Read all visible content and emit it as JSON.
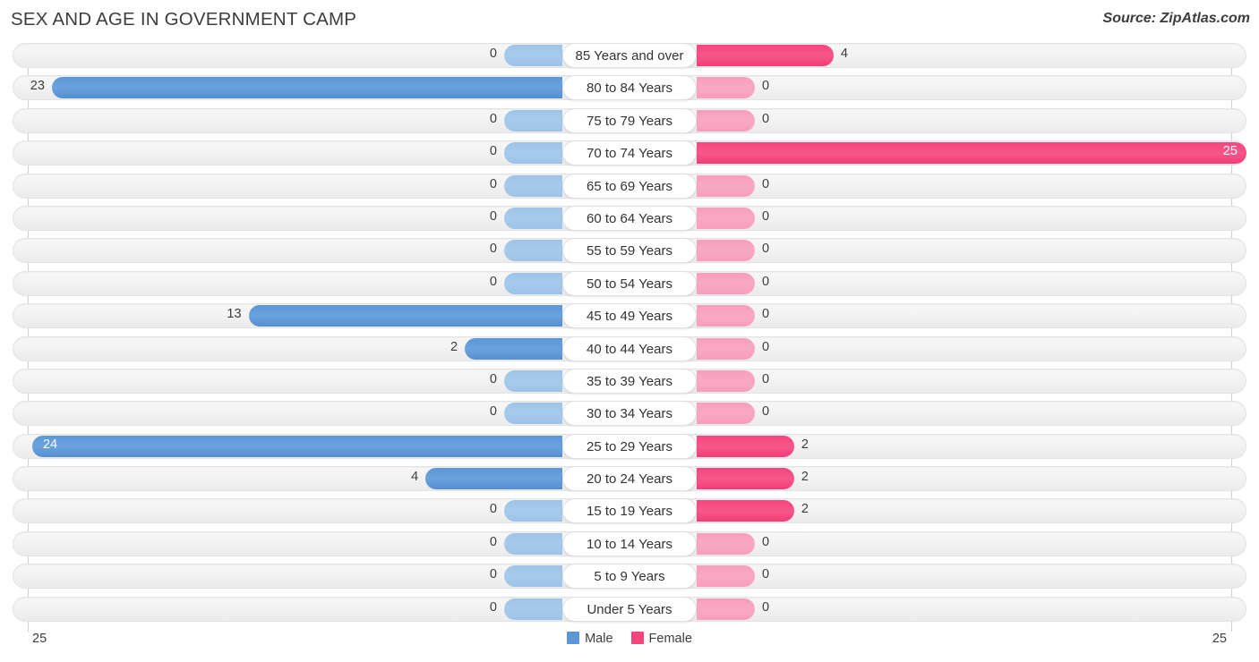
{
  "header": {
    "title": "SEX AND AGE IN GOVERNMENT CAMP",
    "source": "Source: ZipAtlas.com"
  },
  "axis": {
    "left_max": "25",
    "right_max": "25"
  },
  "legend": {
    "items": [
      {
        "label": "Male",
        "color": "#5b97d8"
      },
      {
        "label": "Female",
        "color": "#f4457e"
      }
    ]
  },
  "chart_data": {
    "type": "bar",
    "subtype": "population-pyramid",
    "title": "SEX AND AGE IN GOVERNMENT CAMP",
    "xlabel": "",
    "ylabel": "",
    "xlim": [
      0,
      25
    ],
    "grid": true,
    "legend_position": "bottom-center",
    "categories": [
      "85 Years and over",
      "80 to 84 Years",
      "75 to 79 Years",
      "70 to 74 Years",
      "65 to 69 Years",
      "60 to 64 Years",
      "55 to 59 Years",
      "50 to 54 Years",
      "45 to 49 Years",
      "40 to 44 Years",
      "35 to 39 Years",
      "30 to 34 Years",
      "25 to 29 Years",
      "20 to 24 Years",
      "15 to 19 Years",
      "10 to 14 Years",
      "5 to 9 Years",
      "Under 5 Years"
    ],
    "series": [
      {
        "name": "Male",
        "color": "#5b97d8",
        "values": [
          0,
          23,
          0,
          0,
          0,
          0,
          0,
          0,
          13,
          2,
          0,
          0,
          24,
          4,
          0,
          0,
          0,
          0
        ]
      },
      {
        "name": "Female",
        "color": "#f4457e",
        "values": [
          4,
          0,
          0,
          25,
          0,
          0,
          0,
          0,
          0,
          0,
          0,
          0,
          2,
          2,
          2,
          0,
          0,
          0
        ]
      }
    ]
  }
}
